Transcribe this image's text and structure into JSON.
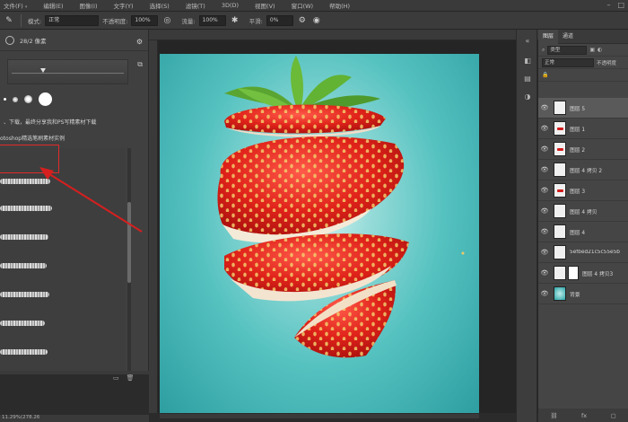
{
  "menubar": {
    "items": [
      "文件(F)",
      "编辑(E)",
      "图像(I)",
      "文字(Y)",
      "选择(S)",
      "滤镜(T)",
      "3D(D)",
      "视图(V)",
      "窗口(W)",
      "帮助(H)"
    ]
  },
  "optbar": {
    "mode_label": "模式:",
    "mode_value": "正常",
    "opacity_label": "不透明度:",
    "opacity_value": "100%",
    "flow_label": "流量:",
    "flow_value": "100%",
    "smooth_label": "平滑:",
    "smooth_value": "0%"
  },
  "brush_panel": {
    "size_text": "28/2 像素",
    "description_line1": "、下载，最终分享我和PS写精素材下载",
    "description_line2": "otoshop精选笔刷素材实例"
  },
  "canvas": {
    "subject": "floating sliced strawberry",
    "background_color": "#4fbfbf"
  },
  "status_bar": {
    "text": "11.29%(278.26"
  },
  "layers_panel": {
    "tabs": [
      "图层",
      "通道"
    ],
    "filter_label": "类型",
    "blend_mode": "正常",
    "opacity_label": "不透明度",
    "layers": [
      {
        "name": "图层 5",
        "selected": true,
        "thumb": "white"
      },
      {
        "name": "图层 1",
        "selected": false,
        "thumb": "red"
      },
      {
        "name": "图层 2",
        "selected": false,
        "thumb": "red"
      },
      {
        "name": "图层 4 拷贝 2",
        "selected": false,
        "thumb": "white"
      },
      {
        "name": "图层 3",
        "selected": false,
        "thumb": "red"
      },
      {
        "name": "图层 4 拷贝",
        "selected": false,
        "thumb": "white"
      },
      {
        "name": "图层 4",
        "selected": false,
        "thumb": "white"
      },
      {
        "name": "5efbed21c5c55e5b",
        "selected": false,
        "thumb": "white"
      },
      {
        "name": "图层 4 拷贝3",
        "selected": false,
        "thumb": "mask"
      },
      {
        "name": "背景",
        "selected": false,
        "thumb": "teal"
      }
    ]
  },
  "colors": {
    "highlight_red": "#e02a2a",
    "panel_bg": "#404040",
    "canvas_teal": "#4fbfbf"
  }
}
